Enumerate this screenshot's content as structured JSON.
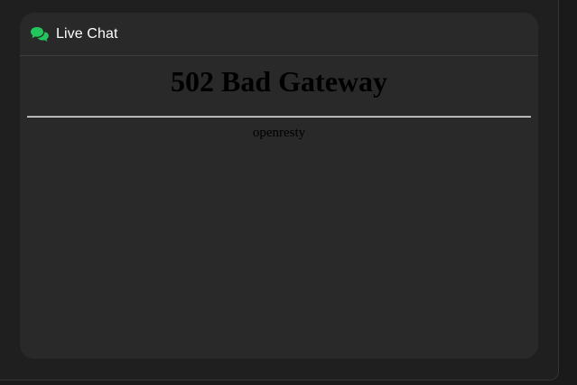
{
  "widget": {
    "title": "Live Chat",
    "icon": "chat-bubbles-icon",
    "accent_color": "#22c55e"
  },
  "error_page": {
    "heading": "502 Bad Gateway",
    "server": "openresty"
  }
}
